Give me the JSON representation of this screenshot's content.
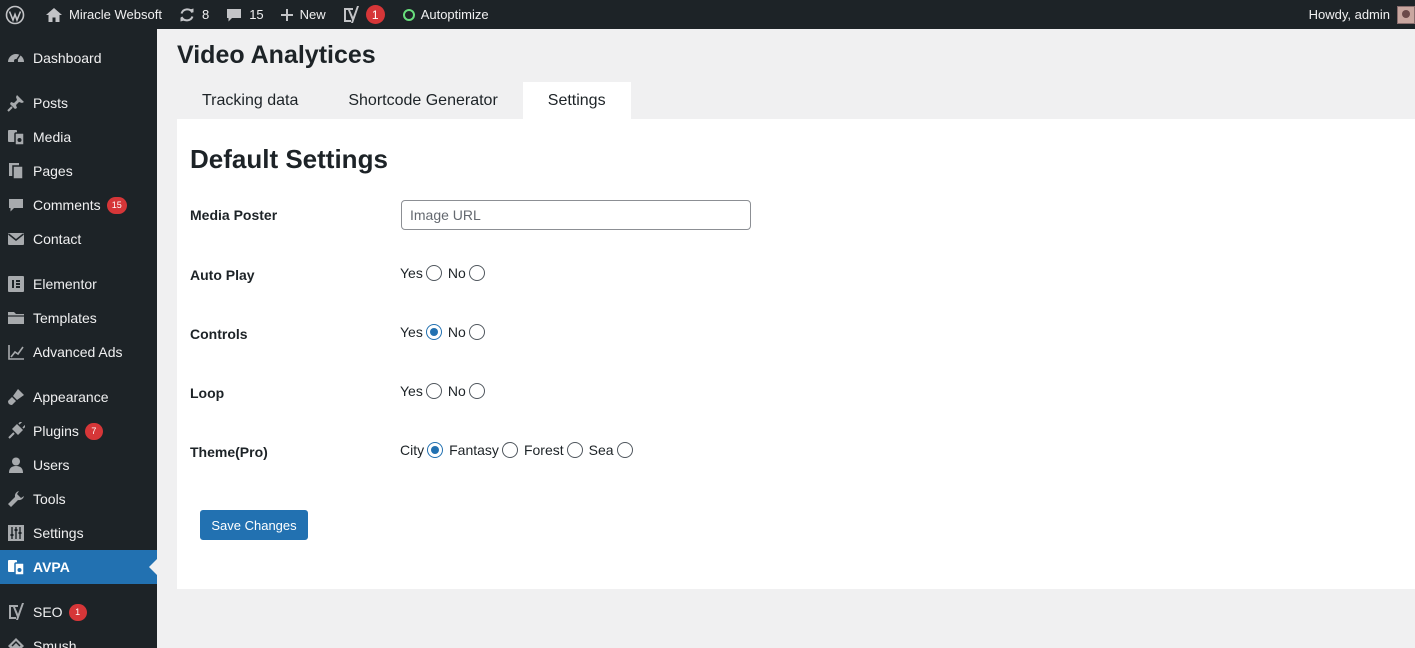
{
  "adminbar": {
    "site_name": "Miracle Websoft",
    "updates_count": "8",
    "comments_count": "15",
    "new_label": "New",
    "yoast_badge": "1",
    "autoptimize_label": "Autoptimize",
    "howdy": "Howdy, admin"
  },
  "sidebar": {
    "items": [
      {
        "label": "Dashboard",
        "icon": "dashboard-icon"
      },
      {
        "label": "Posts",
        "icon": "pin-icon"
      },
      {
        "label": "Media",
        "icon": "media-icon"
      },
      {
        "label": "Pages",
        "icon": "pages-icon"
      },
      {
        "label": "Comments",
        "icon": "comment-icon",
        "badge": "15"
      },
      {
        "label": "Contact",
        "icon": "envelope-icon"
      },
      {
        "label": "Elementor",
        "icon": "elementor-icon"
      },
      {
        "label": "Templates",
        "icon": "folder-icon"
      },
      {
        "label": "Advanced Ads",
        "icon": "chart-line-icon"
      },
      {
        "label": "Appearance",
        "icon": "brush-icon"
      },
      {
        "label": "Plugins",
        "icon": "plug-icon",
        "badge": "7"
      },
      {
        "label": "Users",
        "icon": "user-icon"
      },
      {
        "label": "Tools",
        "icon": "wrench-icon"
      },
      {
        "label": "Settings",
        "icon": "sliders-icon"
      },
      {
        "label": "AVPA",
        "icon": "media-icon"
      },
      {
        "label": "SEO",
        "icon": "yoast-icon",
        "badge": "1"
      },
      {
        "label": "Smush",
        "icon": "smush-icon"
      }
    ]
  },
  "page": {
    "title": "Video Analytices",
    "tabs": [
      "Tracking data",
      "Shortcode Generator",
      "Settings"
    ],
    "active_tab": "Settings"
  },
  "settings": {
    "heading": "Default Settings",
    "media_poster": {
      "label": "Media Poster",
      "placeholder": "Image URL",
      "value": ""
    },
    "auto_play": {
      "label": "Auto Play",
      "options": [
        "Yes",
        "No"
      ],
      "selected": null
    },
    "controls": {
      "label": "Controls",
      "options": [
        "Yes",
        "No"
      ],
      "selected": "Yes"
    },
    "loop": {
      "label": "Loop",
      "options": [
        "Yes",
        "No"
      ],
      "selected": null
    },
    "theme": {
      "label": "Theme(Pro)",
      "options": [
        "City",
        "Fantasy",
        "Forest",
        "Sea"
      ],
      "selected": "City"
    },
    "save_label": "Save Changes"
  },
  "colors": {
    "adminbar_bg": "#1d2327",
    "accent": "#2271b1",
    "badge": "#d63638",
    "content_bg": "#f0f0f1"
  }
}
